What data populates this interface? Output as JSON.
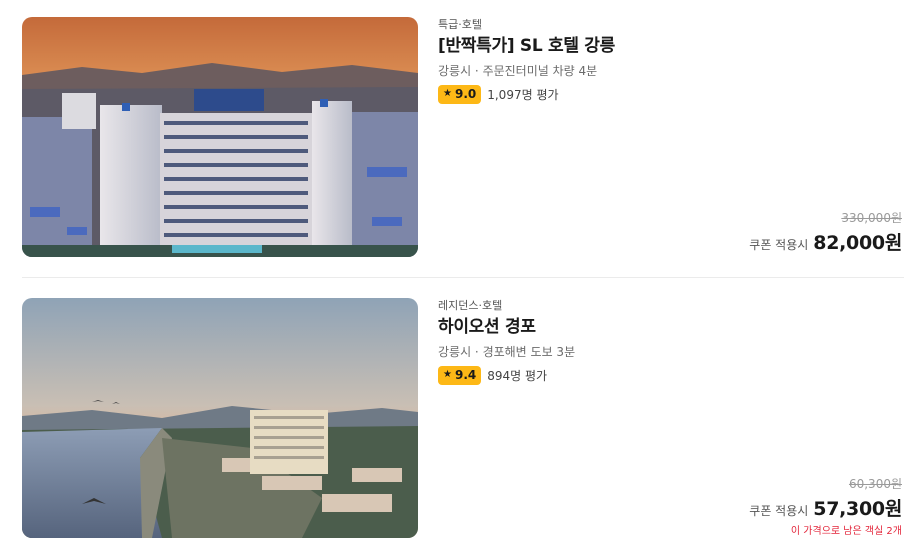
{
  "hotels": [
    {
      "category": "특급·호텔",
      "name": "[반짝특가] SL 호텔 강릉",
      "location": "강릉시 · 주문진터미널 차량 4분",
      "rating": "9.0",
      "reviews": "1,097명 평가",
      "original_price": "330,000원",
      "coupon_label": "쿠폰 적용시",
      "final_price": "82,000원",
      "image": "hotel-exterior-sunset-photo"
    },
    {
      "category": "레지던스·호텔",
      "name": "하이오션 경포",
      "location": "강릉시 · 경포해변 도보 3분",
      "rating": "9.4",
      "reviews": "894명 평가",
      "original_price": "60,300원",
      "coupon_label": "쿠폰 적용시",
      "final_price": "57,300원",
      "rooms_left": "이 가격으로 남은 객실 2개",
      "image": "lakeside-hotel-aerial-photo"
    }
  ],
  "colors": {
    "rating_badge": "#fdb816",
    "warning_text": "#e3263b",
    "strike_price": "#9a9a9a"
  },
  "icons": {
    "rating": "star-icon"
  }
}
